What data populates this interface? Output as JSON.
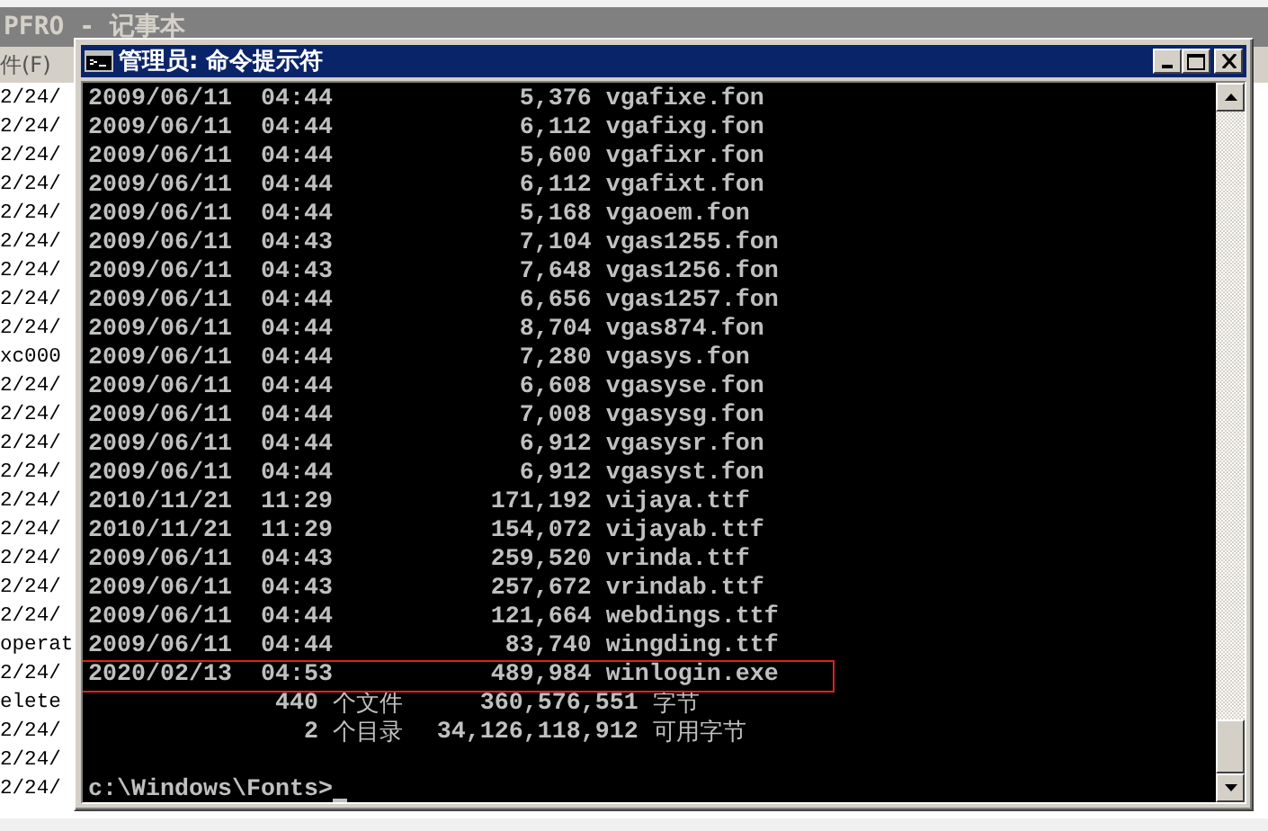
{
  "notepad": {
    "title": "PFRO - 记事本",
    "menu": [
      "件(F)"
    ],
    "lines": [
      "2/24/",
      "2/24/",
      "2/24/",
      "2/24/",
      "2/24/",
      "2/24/",
      "2/24/",
      "2/24/",
      "2/24/",
      "xc000",
      "2/24/",
      "2/24/",
      "2/24/",
      "2/24/",
      "2/24/",
      "2/24/",
      "2/24/",
      "2/24/",
      "2/24/",
      "operat",
      "2/24/",
      "elete",
      "2/24/",
      "2/24/",
      "2/24/"
    ]
  },
  "console": {
    "title": "管理员: 命令提示符",
    "rows": [
      {
        "date": "2009/06/11",
        "time": "04:44",
        "size": "5,376",
        "name": "vgafixe.fon",
        "highlighted": false
      },
      {
        "date": "2009/06/11",
        "time": "04:44",
        "size": "6,112",
        "name": "vgafixg.fon",
        "highlighted": false
      },
      {
        "date": "2009/06/11",
        "time": "04:44",
        "size": "5,600",
        "name": "vgafixr.fon",
        "highlighted": false
      },
      {
        "date": "2009/06/11",
        "time": "04:44",
        "size": "6,112",
        "name": "vgafixt.fon",
        "highlighted": false
      },
      {
        "date": "2009/06/11",
        "time": "04:44",
        "size": "5,168",
        "name": "vgaoem.fon",
        "highlighted": false
      },
      {
        "date": "2009/06/11",
        "time": "04:43",
        "size": "7,104",
        "name": "vgas1255.fon",
        "highlighted": false
      },
      {
        "date": "2009/06/11",
        "time": "04:43",
        "size": "7,648",
        "name": "vgas1256.fon",
        "highlighted": false
      },
      {
        "date": "2009/06/11",
        "time": "04:44",
        "size": "6,656",
        "name": "vgas1257.fon",
        "highlighted": false
      },
      {
        "date": "2009/06/11",
        "time": "04:44",
        "size": "8,704",
        "name": "vgas874.fon",
        "highlighted": false
      },
      {
        "date": "2009/06/11",
        "time": "04:44",
        "size": "7,280",
        "name": "vgasys.fon",
        "highlighted": false
      },
      {
        "date": "2009/06/11",
        "time": "04:44",
        "size": "6,608",
        "name": "vgasyse.fon",
        "highlighted": false
      },
      {
        "date": "2009/06/11",
        "time": "04:44",
        "size": "7,008",
        "name": "vgasysg.fon",
        "highlighted": false
      },
      {
        "date": "2009/06/11",
        "time": "04:44",
        "size": "6,912",
        "name": "vgasysr.fon",
        "highlighted": false
      },
      {
        "date": "2009/06/11",
        "time": "04:44",
        "size": "6,912",
        "name": "vgasyst.fon",
        "highlighted": false
      },
      {
        "date": "2010/11/21",
        "time": "11:29",
        "size": "171,192",
        "name": "vijaya.ttf",
        "highlighted": false
      },
      {
        "date": "2010/11/21",
        "time": "11:29",
        "size": "154,072",
        "name": "vijayab.ttf",
        "highlighted": false
      },
      {
        "date": "2009/06/11",
        "time": "04:43",
        "size": "259,520",
        "name": "vrinda.ttf",
        "highlighted": false
      },
      {
        "date": "2009/06/11",
        "time": "04:43",
        "size": "257,672",
        "name": "vrindab.ttf",
        "highlighted": false
      },
      {
        "date": "2009/06/11",
        "time": "04:44",
        "size": "121,664",
        "name": "webdings.ttf",
        "highlighted": false
      },
      {
        "date": "2009/06/11",
        "time": "04:44",
        "size": "83,740",
        "name": "wingding.ttf",
        "highlighted": false
      },
      {
        "date": "2020/02/13",
        "time": "04:53",
        "size": "489,984",
        "name": "winlogin.exe",
        "highlighted": true
      }
    ],
    "summary": [
      {
        "count": "440",
        "count_label": "个文件",
        "bytes": "360,576,551",
        "bytes_label": "字节"
      },
      {
        "count": "2",
        "count_label": "个目录",
        "bytes": "34,126,118,912",
        "bytes_label": "可用字节"
      }
    ],
    "prompt": "c:\\Windows\\Fonts>"
  }
}
